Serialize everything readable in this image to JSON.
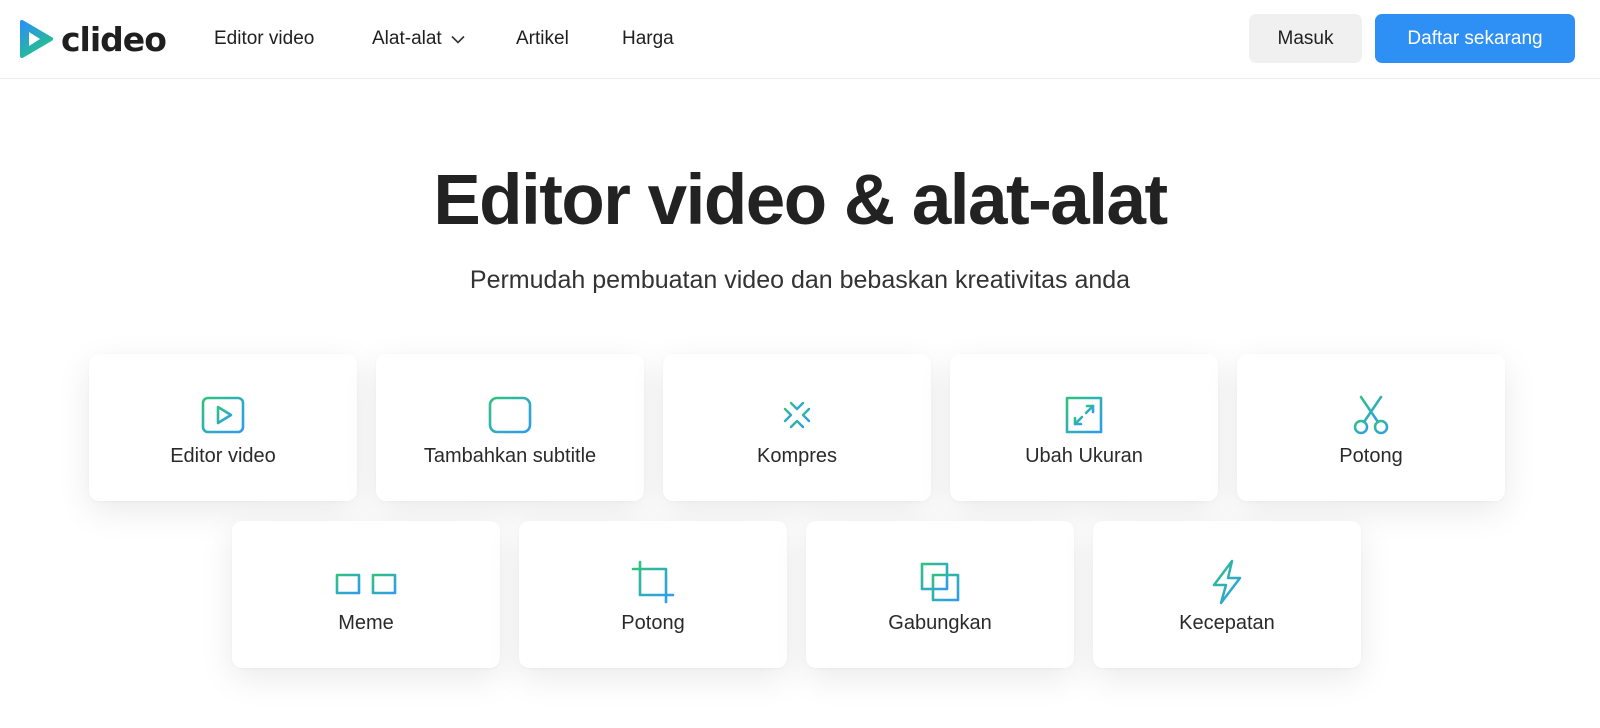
{
  "brand": {
    "name": "clideo",
    "accent": "#2e8ff5",
    "icon_gradient": [
      "#26c281",
      "#2e8ff5"
    ]
  },
  "nav": {
    "editor": "Editor video",
    "tools": "Alat-alat",
    "articles": "Artikel",
    "pricing": "Harga"
  },
  "auth": {
    "login": "Masuk",
    "signup": "Daftar sekarang"
  },
  "hero": {
    "title": "Editor video & alat-alat",
    "subtitle": "Permudah pembuatan video dan bebaskan kreativitas anda"
  },
  "tools": [
    {
      "label": "Editor video",
      "icon": "play-screen-icon"
    },
    {
      "label": "Tambahkan subtitle",
      "icon": "subtitle-icon"
    },
    {
      "label": "Kompres",
      "icon": "compress-arrows-icon"
    },
    {
      "label": "Ubah Ukuran",
      "icon": "resize-icon"
    },
    {
      "label": "Potong",
      "icon": "scissors-icon"
    },
    {
      "label": "Meme",
      "icon": "meme-glasses-icon"
    },
    {
      "label": "Potong",
      "icon": "crop-icon"
    },
    {
      "label": "Gabungkan",
      "icon": "merge-squares-icon"
    },
    {
      "label": "Kecepatan",
      "icon": "lightning-icon"
    }
  ]
}
